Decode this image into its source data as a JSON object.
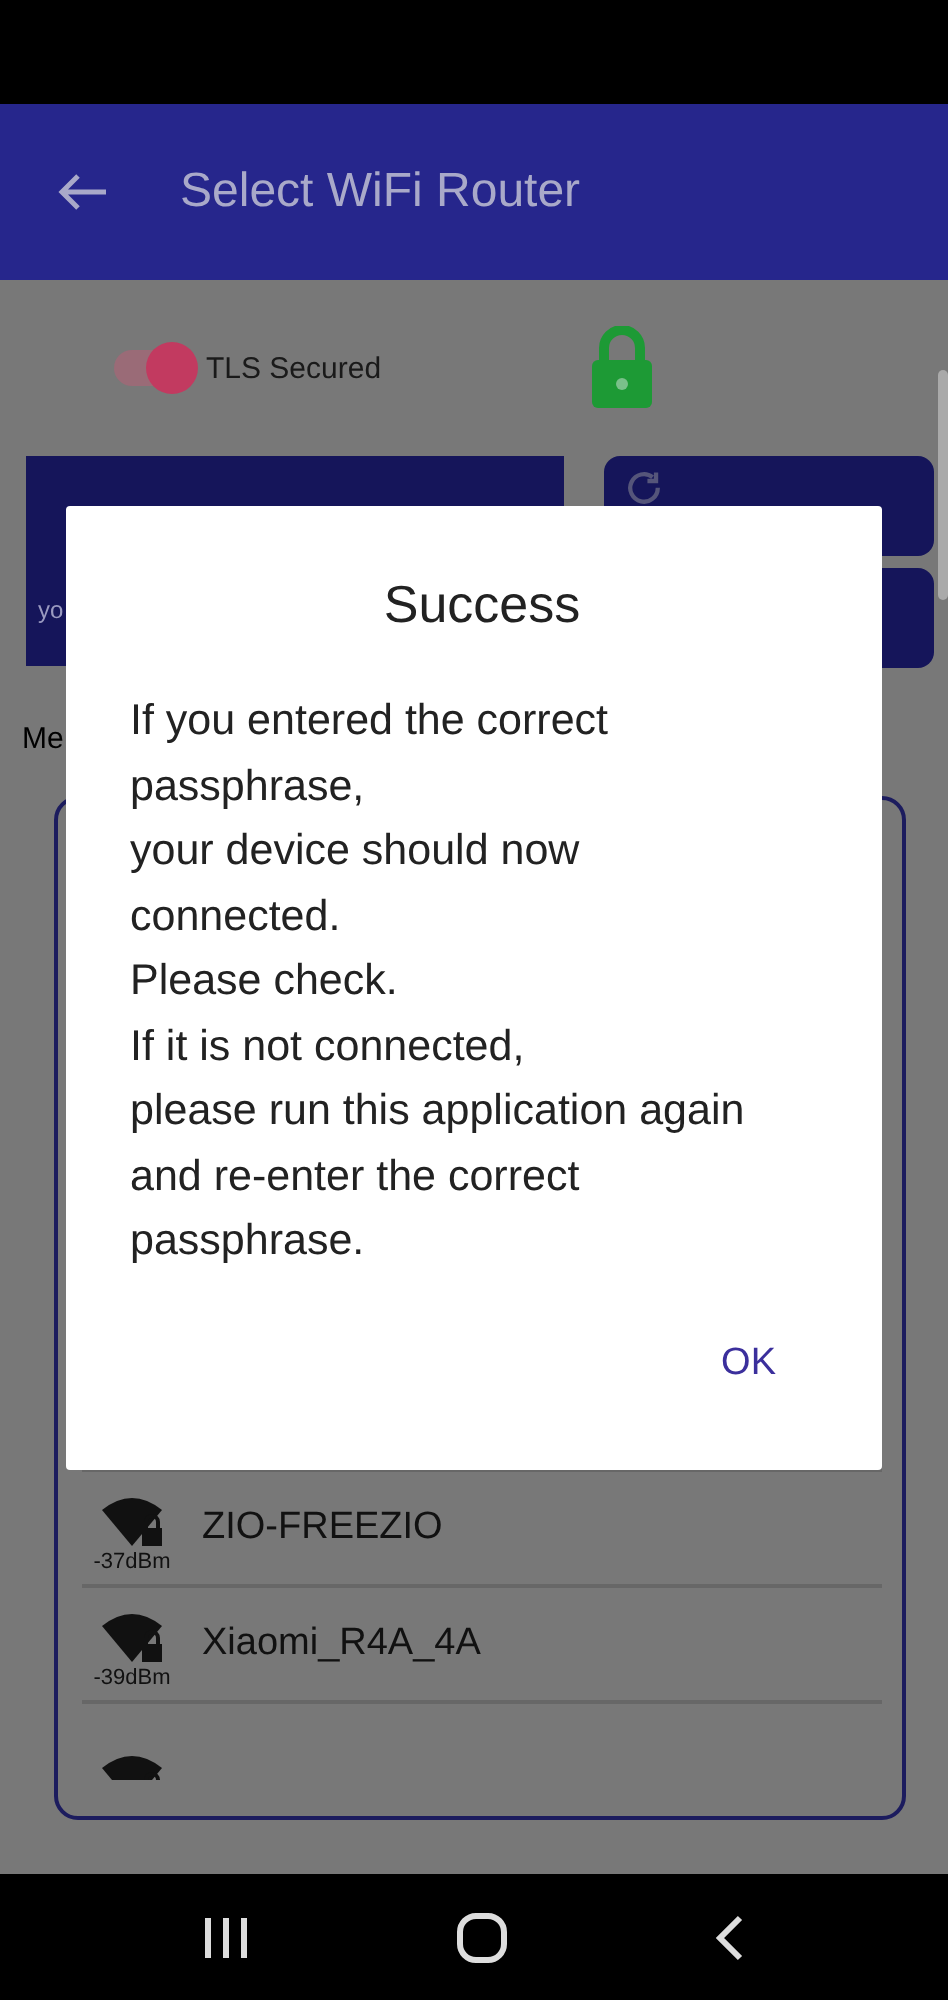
{
  "app_bar": {
    "title": "Select WiFi Router"
  },
  "tls_toggle": {
    "label": "TLS Secured",
    "on": true
  },
  "scan_button": {
    "label": "yo"
  },
  "list_heading": "Me",
  "networks": [
    {
      "ssid": "ZIO-FREEZIO",
      "signal": "-37dBm"
    },
    {
      "ssid": "Xiaomi_R4A_4A",
      "signal": "-39dBm"
    }
  ],
  "dialog": {
    "title": "Success",
    "lines": [
      "If you entered the correct",
      "passphrase,",
      "your device should now",
      "connected.",
      "Please check.",
      "If it is not connected,",
      "please run this application again",
      "and re-enter the correct",
      "passphrase."
    ],
    "button": "OK"
  }
}
